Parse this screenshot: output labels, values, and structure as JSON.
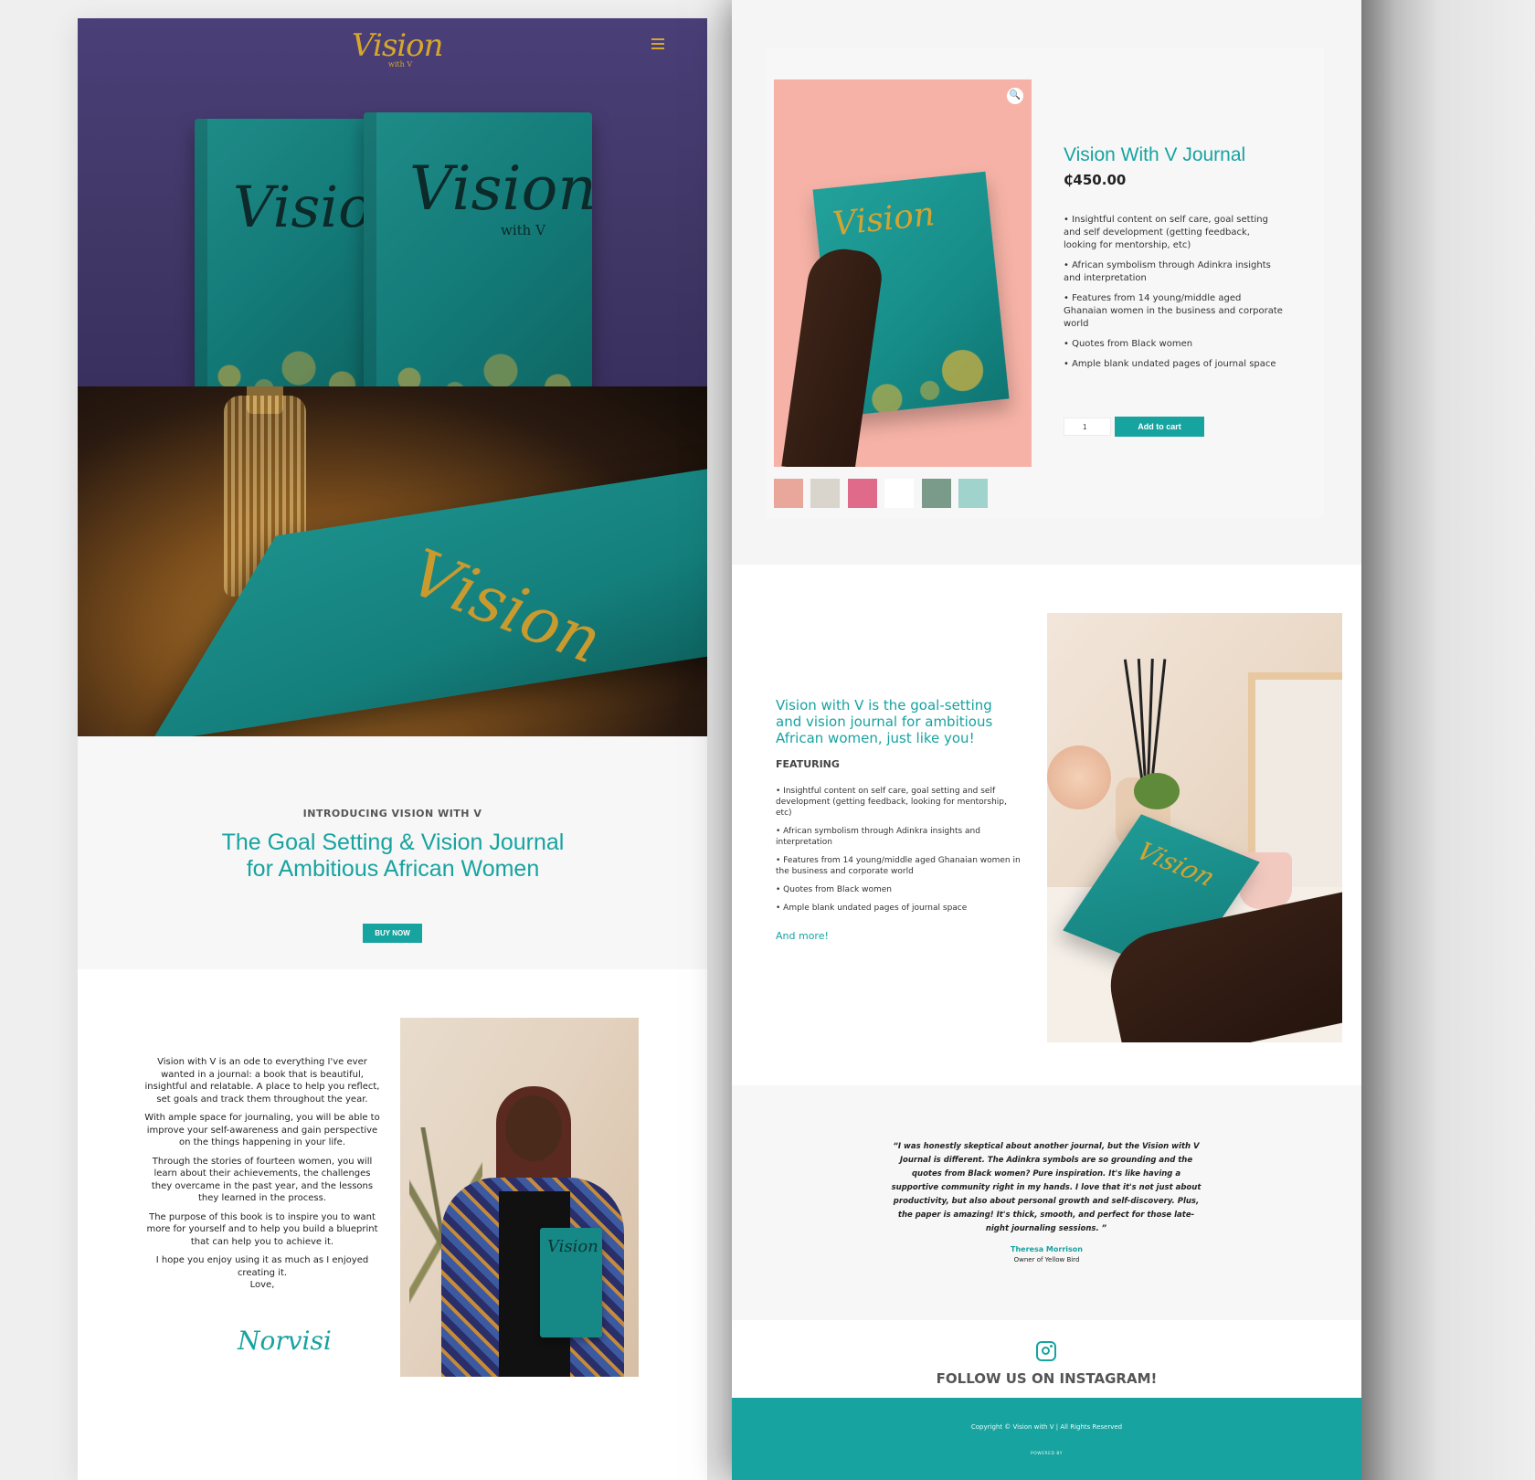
{
  "brand": {
    "logo": "Vision",
    "logo_sub": "with V",
    "teal": "#17a3a0",
    "gold": "#d7a72c"
  },
  "left_page": {
    "hero": {
      "book_cover_text": "Vision",
      "book_cover_sub": "with V"
    },
    "intro": {
      "kicker": "INTRODUCING VISION WITH V",
      "title": "The Goal Setting & Vision Journal for Ambitious African Women",
      "button": "BUY NOW"
    },
    "about": {
      "paragraphs": [
        "Vision with V is an ode to everything I've ever wanted in a journal: a book that is beautiful, insightful and relatable. A place to help you reflect, set goals and track them throughout the year.",
        "With ample space for journaling, you will be able to improve your self-awareness and gain perspective on the things happening in your life.",
        "Through the stories of fourteen women, you will learn about their achievements, the challenges they overcame in the past year, and the lessons they learned in the process.",
        "The purpose of this book is to inspire you to want more for yourself and to help you build a blueprint that can help you to achieve it.",
        "I hope you enjoy using it as much as I enjoyed creating it."
      ],
      "sign_off": "Love,",
      "signature": "Norvisi"
    }
  },
  "right_page": {
    "product": {
      "name": "Vision With V Journal",
      "price": "₵450.00",
      "bullets": [
        "• Insightful content on self care, goal setting and self development (getting feedback, looking for mentorship, etc)",
        "• African symbolism through Adinkra insights and interpretation",
        "• Features from 14 young/middle aged Ghanaian women in the business and corporate world",
        "• Quotes from Black women",
        "• Ample blank undated pages of journal space"
      ],
      "quantity": "1",
      "add_to_cart": "Add to cart",
      "cover_text": "Vision",
      "thumbnails": [
        "#e9a79b",
        "#d9d4cc",
        "#e06a8a",
        "#ffffff",
        "#7a9a8a",
        "#9fd3cc"
      ]
    },
    "feature": {
      "title": "Vision with V is the goal-setting and vision journal for ambitious African women, just like you!",
      "label": "FEATURING",
      "bullets": [
        "• Insightful content on self care, goal setting and self development (getting feedback, looking for mentorship, etc)",
        "• African symbolism through Adinkra insights and interpretation",
        "• Features from 14 young/middle aged Ghanaian women in the business and corporate world",
        "• Quotes from Black women",
        "• Ample blank undated pages of journal space"
      ],
      "more_link": "And more!",
      "cover_text": "Vision"
    },
    "testimonial": {
      "quote": "“I was honestly skeptical about another journal, but the Vision with V Journal is different. The Adinkra symbols are so grounding and the quotes from Black women? Pure inspiration. It's like having a supportive community right in my hands. I love that it's not just about productivity, but also about personal growth and self-discovery. Plus, the paper is amazing! It's thick, smooth, and perfect for those late-night journaling sessions. ”",
      "author": "Theresa Morrison",
      "role": "Owner of Yellow Bird"
    },
    "instagram": {
      "label": "FOLLOW US ON INSTAGRAM!",
      "icon": "instagram-icon"
    },
    "footer": {
      "copyright": "Copyright © Vision with V  |  All Rights Reserved",
      "powered": "POWERED BY"
    }
  }
}
